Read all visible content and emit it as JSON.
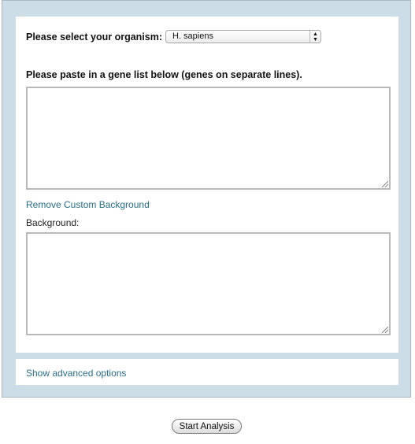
{
  "form": {
    "organism_label": "Please select your organism:",
    "organism_selected": "H. sapiens",
    "gene_list_label": "Please paste in a gene list below (genes on separate lines).",
    "gene_list_value": "",
    "remove_background_link": "Remove Custom Background",
    "background_label": "Background:",
    "background_value": "",
    "advanced_link": "Show advanced options",
    "submit_label": "Start Analysis"
  },
  "icons": {
    "select_arrows": "updown-arrows-icon",
    "resize_grip": "resize-grip-icon"
  },
  "colors": {
    "outer_background": "#cddde7",
    "link": "#2a6f8a",
    "panel": "#ffffff"
  }
}
